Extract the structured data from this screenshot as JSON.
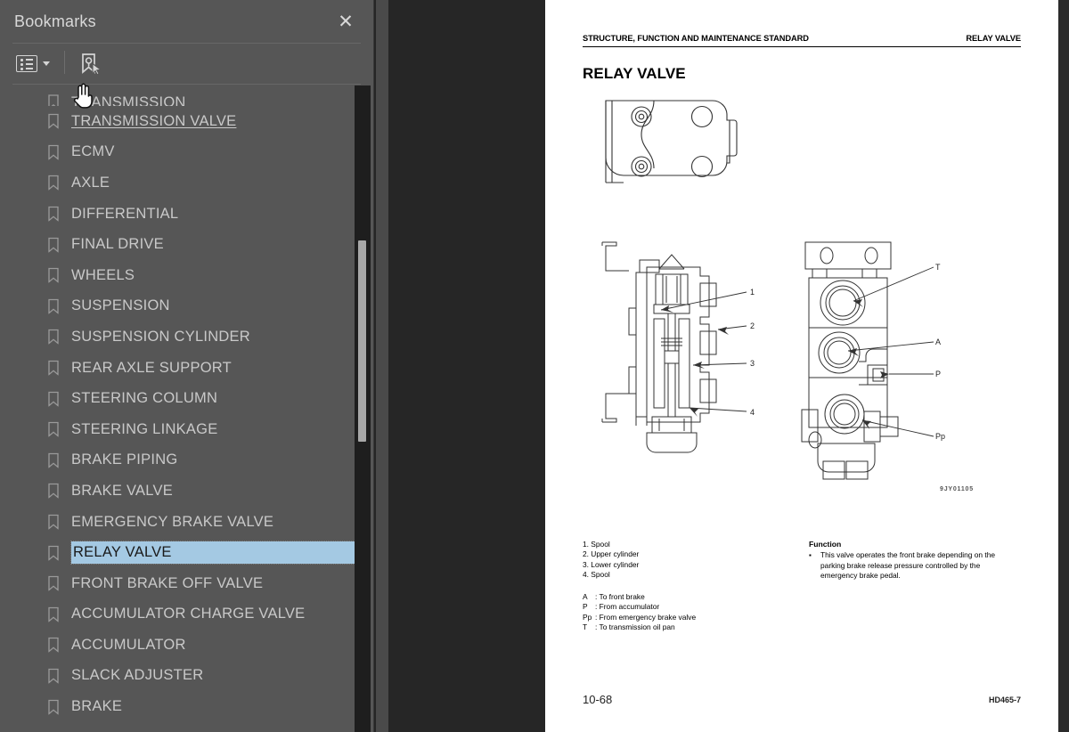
{
  "panel": {
    "title": "Bookmarks",
    "close_label": "✕",
    "toolbar": {
      "list_view_name": "list-options-button",
      "find_bookmark_name": "find-current-bookmark-button"
    },
    "items": [
      {
        "label": "TRANSMISSION",
        "state": "clipped"
      },
      {
        "label": "TRANSMISSION VALVE",
        "state": "underline"
      },
      {
        "label": "ECMV",
        "state": "normal"
      },
      {
        "label": "AXLE",
        "state": "normal"
      },
      {
        "label": "DIFFERENTIAL",
        "state": "normal"
      },
      {
        "label": "FINAL DRIVE",
        "state": "normal"
      },
      {
        "label": "WHEELS",
        "state": "normal"
      },
      {
        "label": "SUSPENSION",
        "state": "normal"
      },
      {
        "label": "SUSPENSION CYLINDER",
        "state": "normal"
      },
      {
        "label": "REAR AXLE SUPPORT",
        "state": "normal"
      },
      {
        "label": "STEERING COLUMN",
        "state": "normal"
      },
      {
        "label": "STEERING LINKAGE",
        "state": "normal"
      },
      {
        "label": "BRAKE PIPING",
        "state": "normal"
      },
      {
        "label": "BRAKE VALVE",
        "state": "normal"
      },
      {
        "label": "EMERGENCY BRAKE VALVE",
        "state": "normal"
      },
      {
        "label": "RELAY VALVE",
        "state": "selected"
      },
      {
        "label": "FRONT BRAKE OFF VALVE",
        "state": "normal"
      },
      {
        "label": "ACCUMULATOR CHARGE VALVE",
        "state": "normal"
      },
      {
        "label": "ACCUMULATOR",
        "state": "normal"
      },
      {
        "label": "SLACK ADJUSTER",
        "state": "normal"
      },
      {
        "label": "BRAKE",
        "state": "normal"
      }
    ]
  },
  "colors": {
    "panel_bg": "#565656",
    "selection": "#a4c9e3",
    "gutter": "#262626",
    "page": "#ffffff",
    "scrollbar_thumb": "#a8a8a8"
  },
  "document": {
    "header_left": "STRUCTURE, FUNCTION AND MAINTENANCE STANDARD",
    "header_right": "RELAY VALVE",
    "title": "RELAY VALVE",
    "figure_id": "9JY01105",
    "parts": [
      "1. Spool",
      "2. Upper cylinder",
      "3. Lower cylinder",
      "4. Spool"
    ],
    "ports": [
      {
        "key": "A",
        "sep": ":",
        "desc": "To front brake"
      },
      {
        "key": "P",
        "sep": ":",
        "desc": "From accumulator"
      },
      {
        "key": "Pp",
        "sep": ":",
        "desc": "From emergency brake valve"
      },
      {
        "key": "T",
        "sep": ":",
        "desc": "To transmission oil pan"
      }
    ],
    "function": {
      "title": "Function",
      "bullet": "▪",
      "text": "This valve operates the front brake depending on the parking brake release pressure controlled by the emergency brake pedal."
    },
    "callouts_left": [
      "1",
      "2",
      "3",
      "4"
    ],
    "callouts_right": [
      "T",
      "A",
      "P",
      "Pp"
    ],
    "page_number": "10-68",
    "model": "HD465-7"
  }
}
